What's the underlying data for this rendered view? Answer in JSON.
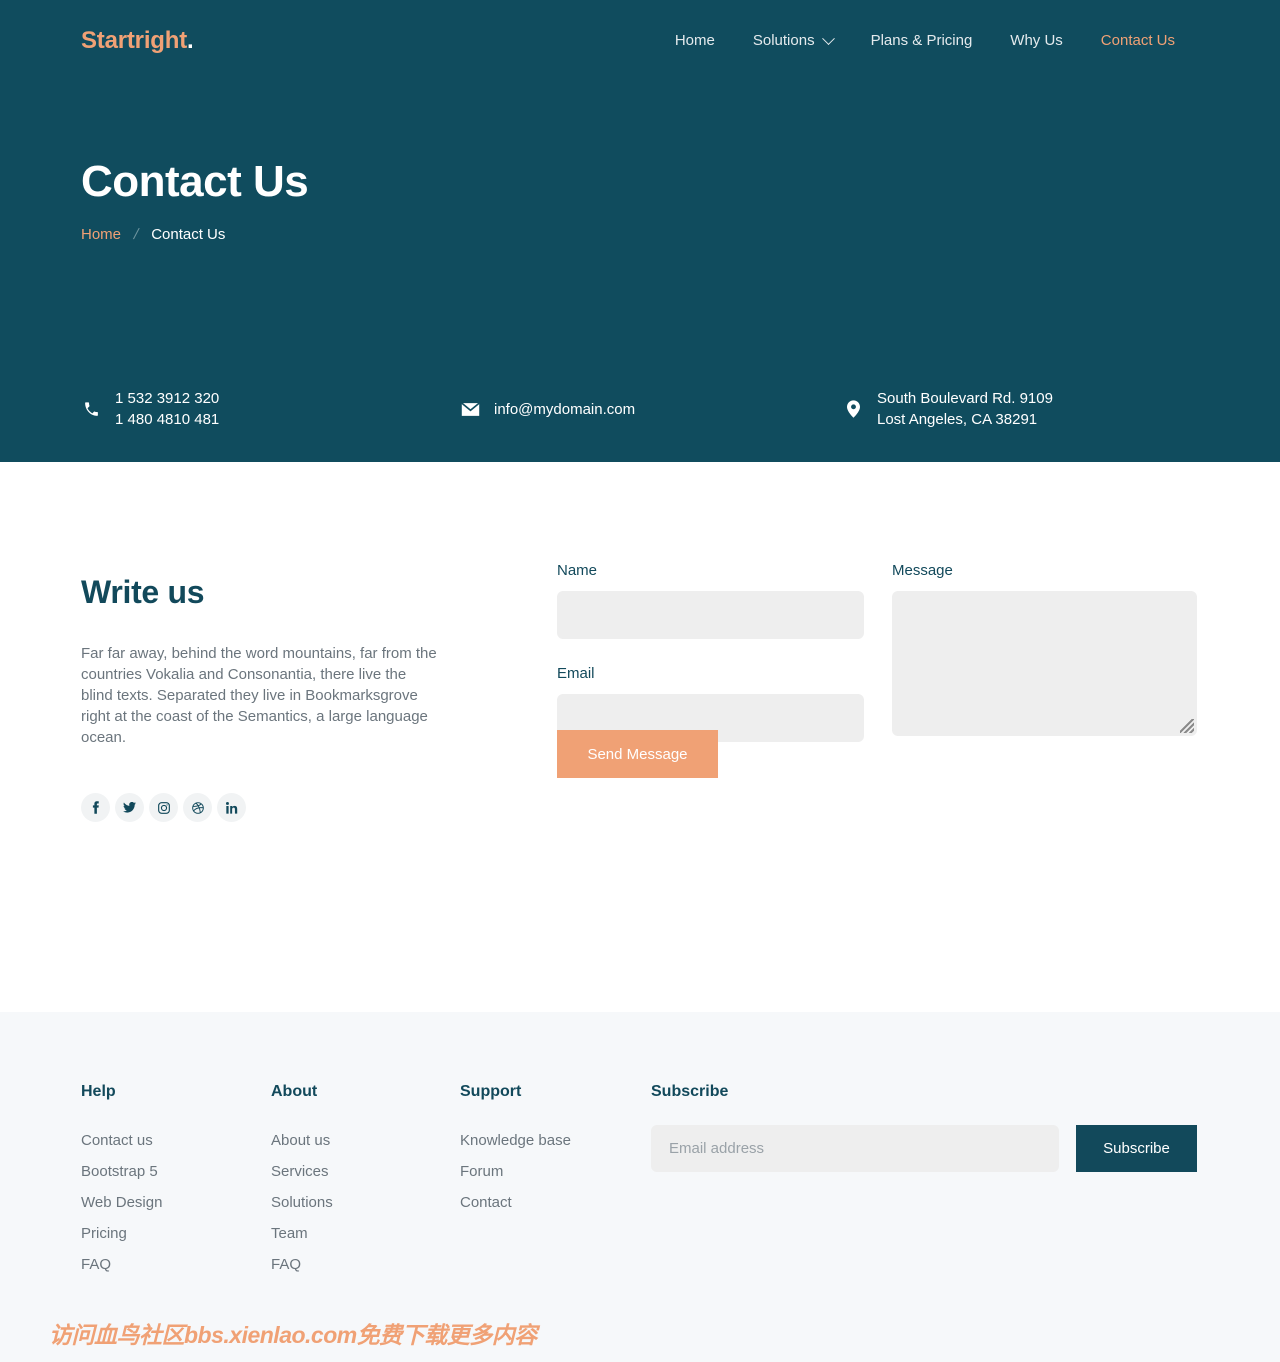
{
  "brand": {
    "name": "Startright",
    "dot": "."
  },
  "nav": {
    "items": [
      {
        "label": "Home",
        "active": false,
        "caret": false
      },
      {
        "label": "Solutions",
        "active": false,
        "caret": true
      },
      {
        "label": "Plans & Pricing",
        "active": false,
        "caret": false
      },
      {
        "label": "Why Us",
        "active": false,
        "caret": false
      },
      {
        "label": "Contact Us",
        "active": true,
        "caret": false
      }
    ]
  },
  "hero": {
    "title": "Contact Us",
    "breadcrumb": {
      "home": "Home",
      "separator": "/",
      "current": "Contact Us"
    },
    "contacts": {
      "phone": {
        "icon": "phone-icon",
        "line1": "1 532 3912 320",
        "line2": "1 480 4810 481"
      },
      "email": {
        "icon": "envelope-icon",
        "value": "info@mydomain.com"
      },
      "address": {
        "icon": "location-pin-icon",
        "line1": "South Boulevard Rd. 9109",
        "line2": "Lost Angeles, CA 38291"
      }
    }
  },
  "write": {
    "title": "Write us",
    "body": "Far far away, behind the word mountains, far from the countries Vokalia and Consonantia, there live the blind texts. Separated they live in Bookmarksgrove right at the coast of the Semantics, a large language ocean.",
    "socials": [
      {
        "name": "facebook-icon"
      },
      {
        "name": "twitter-icon"
      },
      {
        "name": "instagram-icon"
      },
      {
        "name": "dribbble-icon"
      },
      {
        "name": "linkedin-icon"
      }
    ]
  },
  "form": {
    "name_label": "Name",
    "name_value": "",
    "name_placeholder": "",
    "email_label": "Email",
    "email_value": "",
    "email_placeholder": "",
    "message_label": "Message",
    "message_value": "",
    "message_placeholder": "",
    "submit_label": "Send Message"
  },
  "footer": {
    "columns": [
      {
        "heading": "Help",
        "links": [
          "Contact us",
          "Bootstrap 5",
          "Web Design",
          "Pricing",
          "FAQ"
        ]
      },
      {
        "heading": "About",
        "links": [
          "About us",
          "Services",
          "Solutions",
          "Team",
          "FAQ"
        ]
      },
      {
        "heading": "Support",
        "links": [
          "Knowledge base",
          "Forum",
          "Contact"
        ]
      }
    ],
    "subscribe": {
      "heading": "Subscribe",
      "placeholder": "Email address",
      "value": "",
      "button": "Subscribe"
    }
  },
  "watermark": {
    "text": "访问血鸟社区bbs.xienlao.com免费下载更多内容"
  },
  "colors": {
    "hero_bg": "#104c5e",
    "accent": "#f0a175",
    "dark_teal": "#12495b",
    "footer_bg": "#f6f8fa",
    "field_bg": "#eeeeee",
    "muted_text": "#6b757d"
  }
}
